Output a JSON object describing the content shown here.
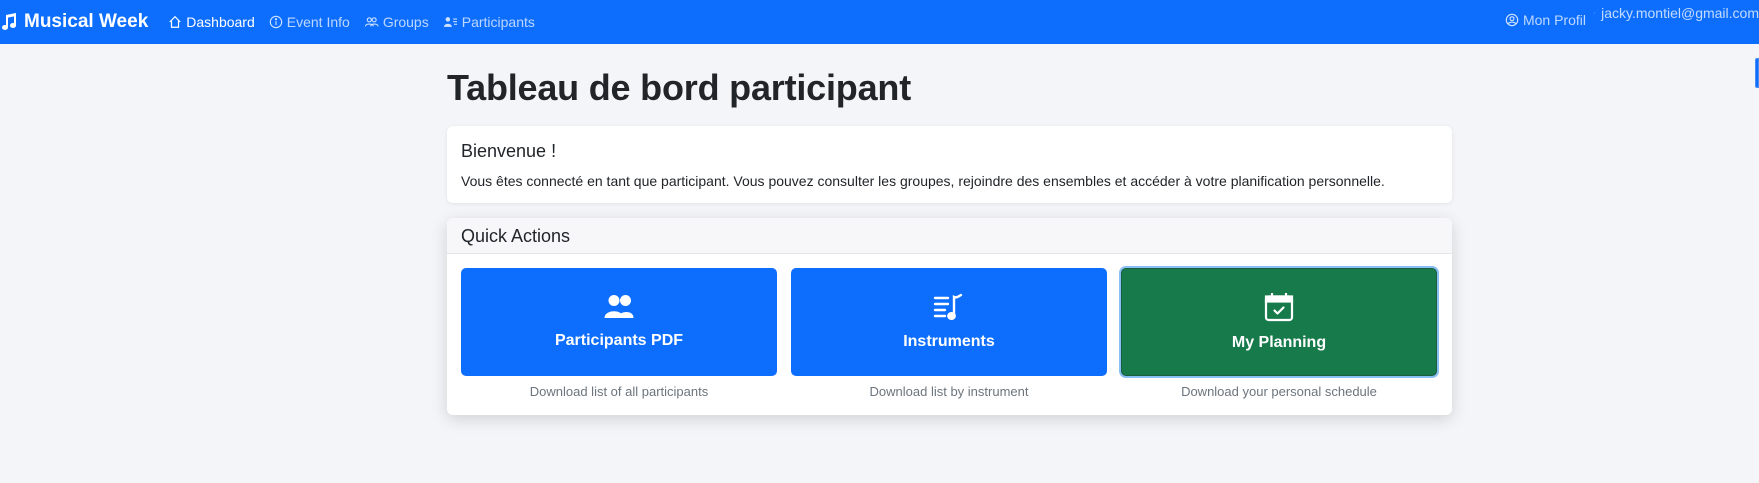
{
  "navbar": {
    "brand": "Musical Week",
    "links": [
      {
        "label": "Dashboard",
        "icon": "house-icon"
      },
      {
        "label": "Event Info",
        "icon": "info-circle-icon"
      },
      {
        "label": "Groups",
        "icon": "people-icon"
      },
      {
        "label": "Participants",
        "icon": "person-lines-icon"
      }
    ],
    "profile": {
      "label": "Mon Profil",
      "icon": "person-circle-icon"
    },
    "user_email": "jacky.montiel@gmail.com"
  },
  "page": {
    "title": "Tableau de bord participant"
  },
  "welcome": {
    "title": "Bienvenue !",
    "text": "Vous êtes connecté en tant que participant. Vous pouvez consulter les groupes, rejoindre des ensembles et accéder à votre planification personnelle."
  },
  "quick_actions": {
    "title": "Quick Actions",
    "items": [
      {
        "label": "Participants PDF",
        "description": "Download list of all participants",
        "icon": "people-fill-icon",
        "color": "#0d6efd"
      },
      {
        "label": "Instruments",
        "description": "Download list by instrument",
        "icon": "music-list-icon",
        "color": "#0d6efd"
      },
      {
        "label": "My Planning",
        "description": "Download your personal schedule",
        "icon": "calendar-check-icon",
        "color": "#177a4b"
      }
    ]
  },
  "colors": {
    "primary": "#0d6efd",
    "success": "#177a4b",
    "background": "#f4f5f8"
  }
}
